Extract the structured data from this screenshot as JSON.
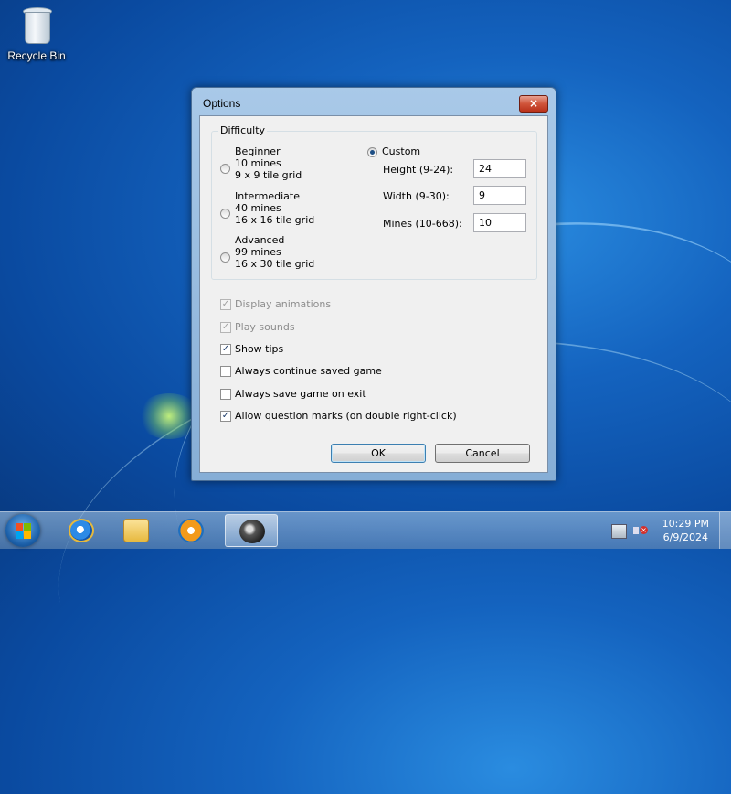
{
  "desktop": {
    "recycle_bin_label": "Recycle Bin"
  },
  "dialog": {
    "title": "Options",
    "close_label": "×",
    "difficulty": {
      "title": "Difficulty",
      "options": [
        {
          "name": "Beginner",
          "mines": "10 mines",
          "grid": "9 x 9 tile grid",
          "selected": false
        },
        {
          "name": "Intermediate",
          "mines": "40 mines",
          "grid": "16 x 16 tile grid",
          "selected": false
        },
        {
          "name": "Advanced",
          "mines": "99 mines",
          "grid": "16 x 30 tile grid",
          "selected": false
        }
      ],
      "custom": {
        "label": "Custom",
        "selected": true,
        "height_label": "Height (9-24):",
        "height_value": "24",
        "width_label": "Width (9-30):",
        "width_value": "9",
        "mines_label": "Mines (10-668):",
        "mines_value": "10"
      }
    },
    "checkboxes": [
      {
        "label": "Display animations",
        "checked": true,
        "enabled": false
      },
      {
        "label": "Play sounds",
        "checked": true,
        "enabled": false
      },
      {
        "label": "Show tips",
        "checked": true,
        "enabled": true
      },
      {
        "label": "Always continue saved game",
        "checked": false,
        "enabled": true
      },
      {
        "label": "Always save game on exit",
        "checked": false,
        "enabled": true
      },
      {
        "label": "Allow question marks (on double right-click)",
        "checked": true,
        "enabled": true
      }
    ],
    "ok_label": "OK",
    "cancel_label": "Cancel"
  },
  "taskbar": {
    "time": "10:29 PM",
    "date": "6/9/2024",
    "items": [
      "start-orb",
      "internet-explorer-icon",
      "windows-explorer-icon",
      "media-player-icon",
      "minesweeper-icon"
    ]
  },
  "colors": {
    "accent": "#3c7fb1",
    "desktop": "#1463bf"
  }
}
